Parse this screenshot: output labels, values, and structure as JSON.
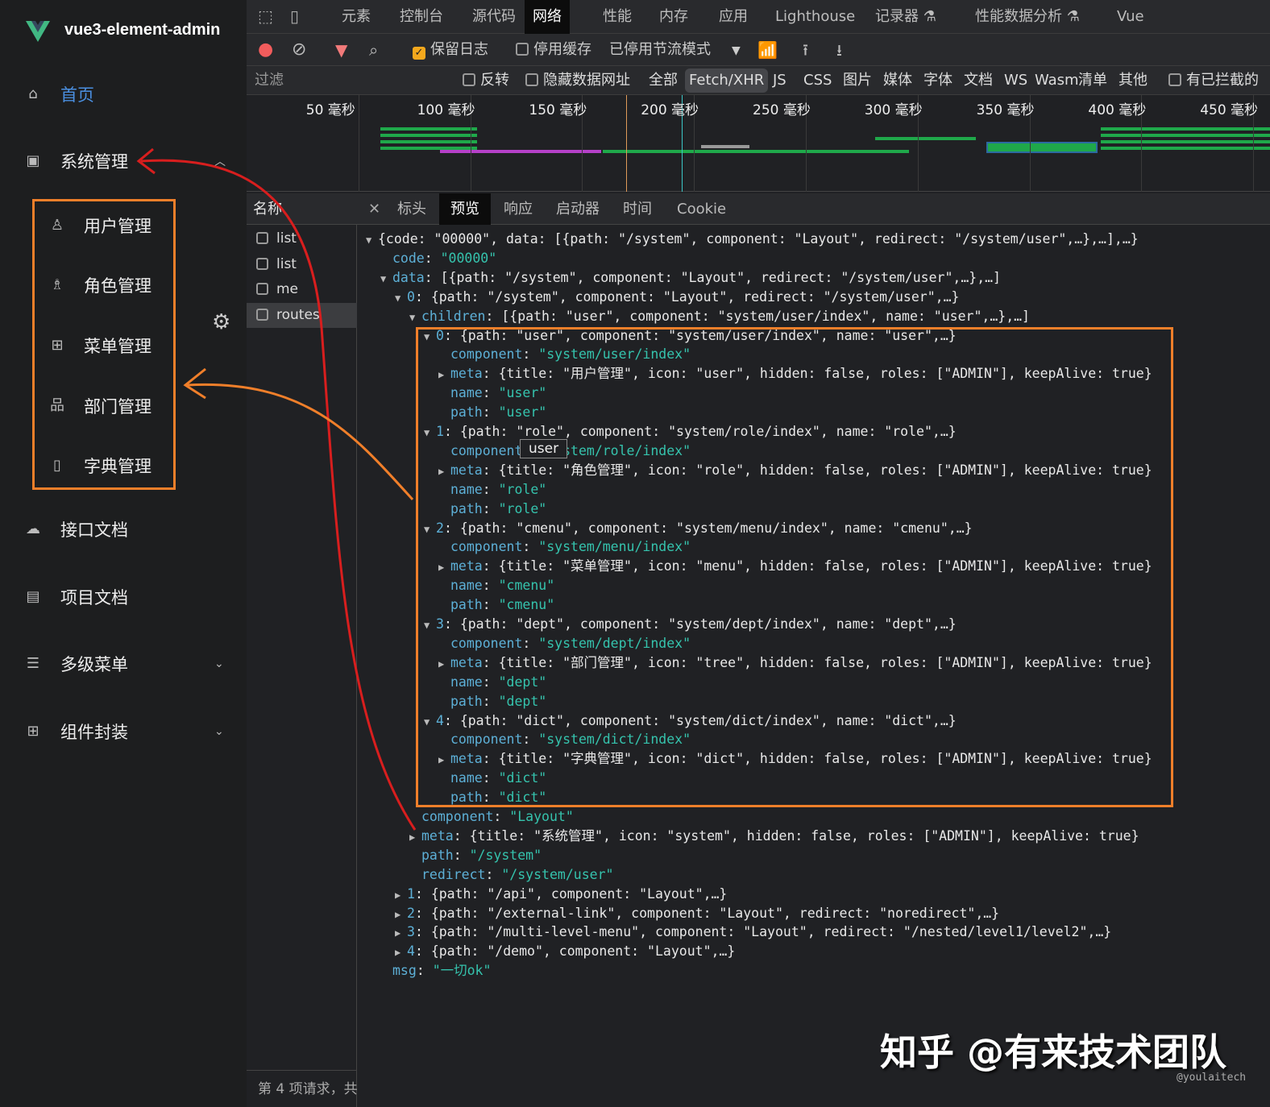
{
  "sidebar": {
    "brand": "vue3-element-admin",
    "home": "首页",
    "system": "系统管理",
    "sub": [
      {
        "label": "用户管理",
        "icon": "user-icon",
        "g": "♙"
      },
      {
        "label": "角色管理",
        "icon": "role-icon",
        "g": "♗"
      },
      {
        "label": "菜单管理",
        "icon": "menu-icon",
        "g": "⊞"
      },
      {
        "label": "部门管理",
        "icon": "tree-icon",
        "g": "品"
      },
      {
        "label": "字典管理",
        "icon": "dict-icon",
        "g": "▯"
      }
    ],
    "items": [
      {
        "label": "接口文档",
        "icon": "api-icon",
        "g": "☁",
        "chev": ""
      },
      {
        "label": "项目文档",
        "icon": "document-icon",
        "g": "▤",
        "chev": ""
      },
      {
        "label": "多级菜单",
        "icon": "nested-menu-icon",
        "g": "☰",
        "chev": "⌄"
      },
      {
        "label": "组件封装",
        "icon": "component-icon",
        "g": "⊞",
        "chev": "⌄"
      }
    ]
  },
  "devtools": {
    "tabs": [
      "元素",
      "控制台",
      "源代码",
      "网络",
      "性能",
      "内存",
      "应用",
      "Lighthouse",
      "记录器 ⚗",
      "性能数据分析 ⚗",
      "Vue"
    ],
    "active_tab": "网络",
    "toolbar": {
      "preserve_log": "保留日志",
      "disable_cache": "停用缓存",
      "throttle": "已停用节流模式"
    },
    "filter": {
      "placeholder": "过滤",
      "invert": "反转",
      "hide_data": "隐藏数据网址",
      "types": [
        "全部",
        "Fetch/XHR",
        "JS",
        "CSS",
        "图片",
        "媒体",
        "字体",
        "文档",
        "WS",
        "Wasm",
        "清单",
        "其他"
      ],
      "active_type": "Fetch/XHR",
      "blocked": "有已拦截的"
    },
    "timeline_ticks": [
      "50 毫秒",
      "100 毫秒",
      "150 毫秒",
      "200 毫秒",
      "250 毫秒",
      "300 毫秒",
      "350 毫秒",
      "400 毫秒",
      "450 毫秒"
    ],
    "names_header": "名称",
    "requests": [
      "list",
      "list",
      "me",
      "routes"
    ],
    "selected_request": "routes",
    "status": "第 4 项请求，共",
    "detail_tabs": [
      "标头",
      "预览",
      "响应",
      "启动器",
      "时间",
      "Cookie"
    ],
    "active_detail_tab": "预览",
    "tooltip": "user",
    "preview": [
      {
        "l": 0,
        "a": "d",
        "k": "",
        "v": "{code: \"00000\", data: [{path: \"/system\", component: \"Layout\", redirect: \"/system/user\",…},…],…}",
        "t": "p"
      },
      {
        "l": 1,
        "a": "",
        "k": "code",
        "v": "\"00000\"",
        "t": "s"
      },
      {
        "l": 1,
        "a": "d",
        "k": "data",
        "v": "[{path: \"/system\", component: \"Layout\", redirect: \"/system/user\",…},…]",
        "t": "p"
      },
      {
        "l": 2,
        "a": "d",
        "k": "0",
        "v": "{path: \"/system\", component: \"Layout\", redirect: \"/system/user\",…}",
        "t": "p"
      },
      {
        "l": 3,
        "a": "d",
        "k": "children",
        "v": "[{path: \"user\", component: \"system/user/index\", name: \"user\",…},…]",
        "t": "p"
      },
      {
        "l": 4,
        "a": "d",
        "k": "0",
        "v": "{path: \"user\", component: \"system/user/index\", name: \"user\",…}",
        "t": "p"
      },
      {
        "l": 5,
        "a": "",
        "k": "component",
        "v": "\"system/user/index\"",
        "t": "s"
      },
      {
        "l": 5,
        "a": "r",
        "k": "meta",
        "v": "{title: \"用户管理\", icon: \"user\", hidden: false, roles: [\"ADMIN\"], keepAlive: true}",
        "t": "p"
      },
      {
        "l": 5,
        "a": "",
        "k": "name",
        "v": "\"user\"",
        "t": "s"
      },
      {
        "l": 5,
        "a": "",
        "k": "path",
        "v": "\"user\"",
        "t": "s"
      },
      {
        "l": 4,
        "a": "d",
        "k": "1",
        "v": "{path: \"role\", component: \"system/role/index\", name: \"role\",…}",
        "t": "p"
      },
      {
        "l": 5,
        "a": "",
        "k": "component",
        "v": "\"system/role/index\"",
        "t": "s"
      },
      {
        "l": 5,
        "a": "r",
        "k": "meta",
        "v": "{title: \"角色管理\", icon: \"role\", hidden: false, roles: [\"ADMIN\"], keepAlive: true}",
        "t": "p"
      },
      {
        "l": 5,
        "a": "",
        "k": "name",
        "v": "\"role\"",
        "t": "s"
      },
      {
        "l": 5,
        "a": "",
        "k": "path",
        "v": "\"role\"",
        "t": "s"
      },
      {
        "l": 4,
        "a": "d",
        "k": "2",
        "v": "{path: \"cmenu\", component: \"system/menu/index\", name: \"cmenu\",…}",
        "t": "p"
      },
      {
        "l": 5,
        "a": "",
        "k": "component",
        "v": "\"system/menu/index\"",
        "t": "s"
      },
      {
        "l": 5,
        "a": "r",
        "k": "meta",
        "v": "{title: \"菜单管理\", icon: \"menu\", hidden: false, roles: [\"ADMIN\"], keepAlive: true}",
        "t": "p"
      },
      {
        "l": 5,
        "a": "",
        "k": "name",
        "v": "\"cmenu\"",
        "t": "s"
      },
      {
        "l": 5,
        "a": "",
        "k": "path",
        "v": "\"cmenu\"",
        "t": "s"
      },
      {
        "l": 4,
        "a": "d",
        "k": "3",
        "v": "{path: \"dept\", component: \"system/dept/index\", name: \"dept\",…}",
        "t": "p"
      },
      {
        "l": 5,
        "a": "",
        "k": "component",
        "v": "\"system/dept/index\"",
        "t": "s"
      },
      {
        "l": 5,
        "a": "r",
        "k": "meta",
        "v": "{title: \"部门管理\", icon: \"tree\", hidden: false, roles: [\"ADMIN\"], keepAlive: true}",
        "t": "p"
      },
      {
        "l": 5,
        "a": "",
        "k": "name",
        "v": "\"dept\"",
        "t": "s"
      },
      {
        "l": 5,
        "a": "",
        "k": "path",
        "v": "\"dept\"",
        "t": "s"
      },
      {
        "l": 4,
        "a": "d",
        "k": "4",
        "v": "{path: \"dict\", component: \"system/dict/index\", name: \"dict\",…}",
        "t": "p"
      },
      {
        "l": 5,
        "a": "",
        "k": "component",
        "v": "\"system/dict/index\"",
        "t": "s"
      },
      {
        "l": 5,
        "a": "r",
        "k": "meta",
        "v": "{title: \"字典管理\", icon: \"dict\", hidden: false, roles: [\"ADMIN\"], keepAlive: true}",
        "t": "p"
      },
      {
        "l": 5,
        "a": "",
        "k": "name",
        "v": "\"dict\"",
        "t": "s"
      },
      {
        "l": 5,
        "a": "",
        "k": "path",
        "v": "\"dict\"",
        "t": "s"
      },
      {
        "l": 3,
        "a": "",
        "k": "component",
        "v": "\"Layout\"",
        "t": "s"
      },
      {
        "l": 3,
        "a": "r",
        "k": "meta",
        "v": "{title: \"系统管理\", icon: \"system\", hidden: false, roles: [\"ADMIN\"], keepAlive: true}",
        "t": "p"
      },
      {
        "l": 3,
        "a": "",
        "k": "path",
        "v": "\"/system\"",
        "t": "s"
      },
      {
        "l": 3,
        "a": "",
        "k": "redirect",
        "v": "\"/system/user\"",
        "t": "s"
      },
      {
        "l": 2,
        "a": "r",
        "k": "1",
        "v": "{path: \"/api\", component: \"Layout\",…}",
        "t": "p"
      },
      {
        "l": 2,
        "a": "r",
        "k": "2",
        "v": "{path: \"/external-link\", component: \"Layout\", redirect: \"noredirect\",…}",
        "t": "p"
      },
      {
        "l": 2,
        "a": "r",
        "k": "3",
        "v": "{path: \"/multi-level-menu\", component: \"Layout\", redirect: \"/nested/level1/level2\",…}",
        "t": "p"
      },
      {
        "l": 2,
        "a": "r",
        "k": "4",
        "v": "{path: \"/demo\", component: \"Layout\",…}",
        "t": "p"
      },
      {
        "l": 1,
        "a": "",
        "k": "msg",
        "v": "\"一切ok\"",
        "t": "s"
      }
    ]
  },
  "watermark": {
    "main": "知乎 @有来技术团队",
    "sub": "@youlaitech"
  },
  "colors": {
    "accent_orange": "#f07f2a",
    "annotation_red": "#d81e1e",
    "link_blue": "#4a8fe0"
  }
}
